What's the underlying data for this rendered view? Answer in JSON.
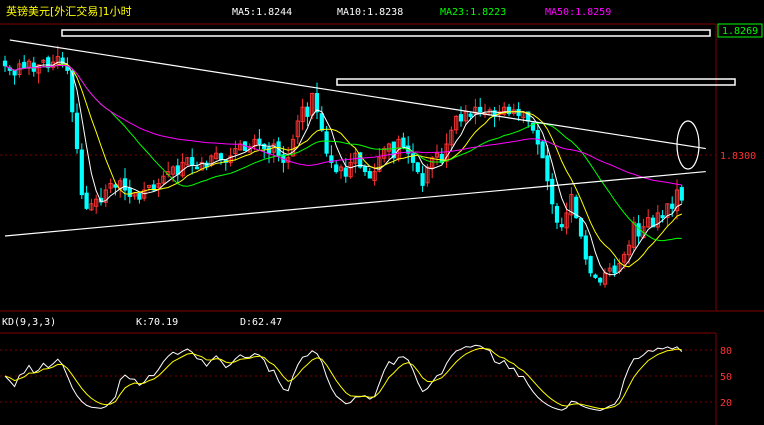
{
  "header": {
    "title": "英镑美元[外汇交易]1小时",
    "ma_labels": [
      {
        "text": "MA5:1.8244",
        "color": "#ffffff"
      },
      {
        "text": "MA10:1.8238",
        "color": "#ffffff"
      },
      {
        "text": "MA23:1.8223",
        "color": "#00ff00"
      },
      {
        "text": "MA50:1.8259",
        "color": "#ff00ff"
      }
    ]
  },
  "price_axis": {
    "current_price": "1.8269",
    "tick_label": "1.8300"
  },
  "indicator": {
    "name": "KD(9,3,3)",
    "k_label": "K:70.19",
    "d_label": "D:62.47",
    "ticks": [
      "80",
      "50",
      "20"
    ]
  },
  "colors": {
    "background": "#000000",
    "up_candle": "#ff3232",
    "down_candle": "#00ffff",
    "ma5": "#ffffff",
    "ma10": "#ffff00",
    "ma23": "#00ff00",
    "ma50": "#ff00ff",
    "title": "#ffff00",
    "grid": "#800000",
    "trendline": "#ffffff"
  },
  "chart_data": [
    {
      "type": "candlestick",
      "timeframe": "1 hour",
      "y_labels": [
        "1.8269",
        "1.8300"
      ],
      "series": [
        {
          "name": "MA5",
          "last": 1.8244
        },
        {
          "name": "MA10",
          "last": 1.8238
        },
        {
          "name": "MA23",
          "last": 1.8223
        },
        {
          "name": "MA50",
          "last": 1.8259
        }
      ],
      "closes": [
        1.839,
        1.8385,
        1.838,
        1.8392,
        1.8388,
        1.8395,
        1.8384,
        1.8391,
        1.8396,
        1.8388,
        1.8394,
        1.84,
        1.8392,
        1.8385,
        1.834,
        1.83,
        1.825,
        1.8235,
        1.824,
        1.8245,
        1.8242,
        1.8255,
        1.8262,
        1.8258,
        1.8265,
        1.8255,
        1.8248,
        1.8252,
        1.8245,
        1.8255,
        1.826,
        1.8255,
        1.8262,
        1.827,
        1.8275,
        1.828,
        1.8272,
        1.8285,
        1.829,
        1.8282,
        1.8278,
        1.8285,
        1.828,
        1.8292,
        1.8295,
        1.8288,
        1.8285,
        1.8292,
        1.83,
        1.8305,
        1.8298,
        1.8302,
        1.831,
        1.8305,
        1.83,
        1.8295,
        1.8305,
        1.8292,
        1.8285,
        1.829,
        1.831,
        1.833,
        1.8345,
        1.8335,
        1.836,
        1.834,
        1.832,
        1.8295,
        1.8285,
        1.8275,
        1.828,
        1.827,
        1.8285,
        1.8295,
        1.828,
        1.8275,
        1.8268,
        1.8275,
        1.829,
        1.83,
        1.8305,
        1.829,
        1.831,
        1.8302,
        1.8295,
        1.8285,
        1.8275,
        1.826,
        1.828,
        1.829,
        1.8295,
        1.8285,
        1.8305,
        1.832,
        1.8335,
        1.833,
        1.834,
        1.8335,
        1.8345,
        1.834,
        1.8338,
        1.8342,
        1.8335,
        1.834,
        1.8345,
        1.8338,
        1.8342,
        1.8336,
        1.834,
        1.833,
        1.832,
        1.8305,
        1.829,
        1.8265,
        1.824,
        1.822,
        1.8215,
        1.823,
        1.825,
        1.8225,
        1.8205,
        1.818,
        1.8165,
        1.816,
        1.8155,
        1.8165,
        1.817,
        1.8165,
        1.8175,
        1.8185,
        1.8195,
        1.822,
        1.8205,
        1.8215,
        1.8225,
        1.8215,
        1.823,
        1.8225,
        1.824,
        1.8235,
        1.8255,
        1.8244
      ],
      "trendlines": [
        {
          "from": [
            1,
            1.8418
          ],
          "to": [
            146,
            1.83
          ]
        },
        {
          "from": [
            0,
            1.8205
          ],
          "to": [
            146,
            1.8275
          ]
        }
      ]
    },
    {
      "type": "line",
      "indicator": "KD(9,3,3)",
      "y_ticks": [
        80,
        50,
        20
      ],
      "series": [
        {
          "name": "K",
          "last": 70.19
        },
        {
          "name": "D",
          "last": 62.47
        }
      ]
    }
  ]
}
